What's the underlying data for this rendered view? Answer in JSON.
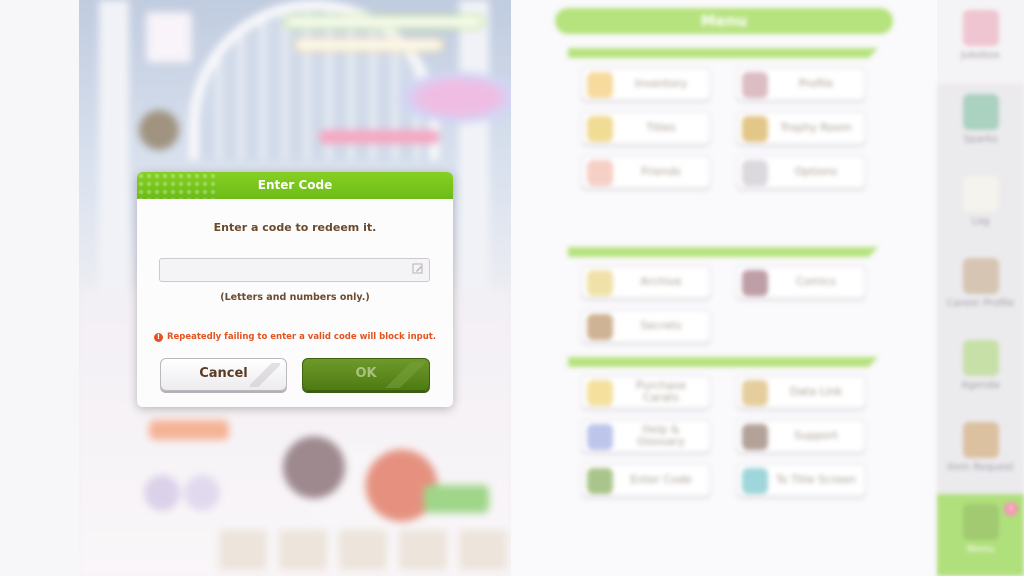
{
  "dialog": {
    "title": "Enter Code",
    "prompt": "Enter a code to redeem it.",
    "input_value": "",
    "hint": "(Letters and numbers only.)",
    "warning": "Repeatedly failing to enter a valid code will block input.",
    "warning_icon": "!",
    "cancel_label": "Cancel",
    "ok_label": "OK"
  },
  "menu": {
    "title": "Menu",
    "items": [
      {
        "label": "Inventory",
        "icon": "inventory-icon"
      },
      {
        "label": "Profile",
        "icon": "profile-icon"
      },
      {
        "label": "Titles",
        "icon": "titles-icon"
      },
      {
        "label": "Trophy Room",
        "icon": "trophy-icon"
      },
      {
        "label": "Friends",
        "icon": "friends-icon"
      },
      {
        "label": "Options",
        "icon": "options-icon"
      },
      {
        "label": "Archive",
        "icon": "archive-icon"
      },
      {
        "label": "Comics",
        "icon": "comics-icon"
      },
      {
        "label": "Secrets",
        "icon": "secrets-icon"
      },
      {
        "label": "Purchase Carats",
        "icon": "carats-icon"
      },
      {
        "label": "Data Link",
        "icon": "data-link-icon"
      },
      {
        "label": "Help & Glossary",
        "icon": "help-icon"
      },
      {
        "label": "Support",
        "icon": "support-icon"
      },
      {
        "label": "Enter Code",
        "icon": "enter-code-icon"
      },
      {
        "label": "To Title Screen",
        "icon": "title-screen-icon"
      }
    ]
  },
  "sidebar": {
    "items": [
      {
        "label": "Jukebox",
        "icon": "jukebox-icon"
      },
      {
        "label": "Sparks",
        "icon": "sparks-icon"
      },
      {
        "label": "Log",
        "icon": "log-icon"
      },
      {
        "label": "Career Profile",
        "icon": "career-profile-icon"
      },
      {
        "label": "Agenda",
        "icon": "agenda-icon"
      },
      {
        "label": "Item Request",
        "icon": "item-request-icon"
      },
      {
        "label": "Menu",
        "icon": "menu-icon",
        "badge": "1"
      }
    ]
  },
  "colors": {
    "accent_green": "#86d023",
    "warning_orange": "#e4531e",
    "text_brown": "#6b4a2c"
  }
}
